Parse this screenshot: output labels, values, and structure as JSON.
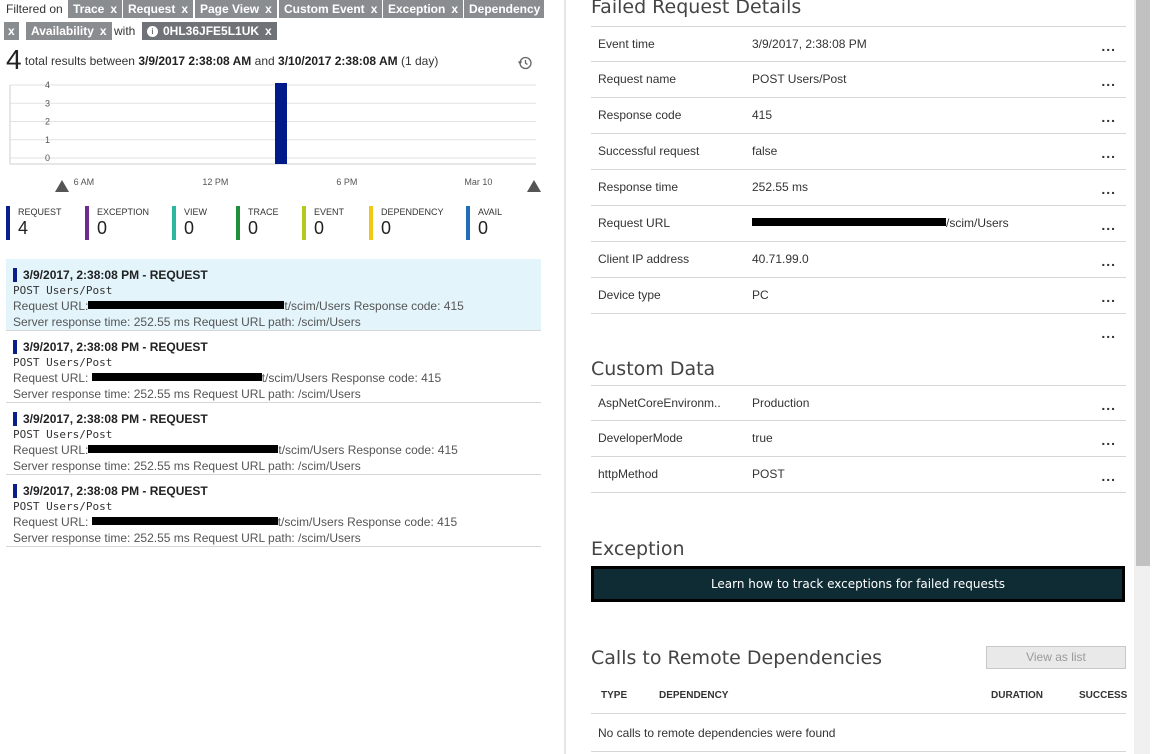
{
  "filters": {
    "label": "Filtered on",
    "chips": [
      "Trace",
      "Request",
      "Page View",
      "Custom Event",
      "Exception",
      "Dependency",
      "x",
      "Availability"
    ],
    "with_label": "with",
    "operation_chip": "0HL36JFE5L1UK",
    "chip_close": "x"
  },
  "summary": {
    "count": "4",
    "text_prefix": "total results between",
    "start": "3/9/2017 2:38:08 AM",
    "and": "and",
    "end": "3/10/2017 2:38:08 AM",
    "span": "(1 day)"
  },
  "chart_data": {
    "type": "bar",
    "title": "",
    "xlabel": "",
    "ylabel": "",
    "y_ticks": [
      "4",
      "3",
      "2",
      "1",
      "0"
    ],
    "ylim": [
      0,
      4
    ],
    "x_ticks": [
      "6 AM",
      "12 PM",
      "6 PM",
      "Mar 10"
    ],
    "bars": [
      {
        "x": "3/9/2017 2:38 PM",
        "value": 4,
        "color": "#001a8a"
      }
    ]
  },
  "legend": [
    {
      "label": "REQUEST",
      "count": "4",
      "color": "#0b1f8a"
    },
    {
      "label": "EXCEPTION",
      "count": "0",
      "color": "#6d2c8f"
    },
    {
      "label": "VIEW",
      "count": "0",
      "color": "#2bb8a0"
    },
    {
      "label": "TRACE",
      "count": "0",
      "color": "#1f8f3a"
    },
    {
      "label": "EVENT",
      "count": "0",
      "color": "#b8c91e"
    },
    {
      "label": "DEPENDENCY",
      "count": "0",
      "color": "#f2c811"
    },
    {
      "label": "AVAIL",
      "count": "0",
      "color": "#1e6fb5"
    }
  ],
  "results": [
    {
      "title": "3/9/2017, 2:38:08 PM - REQUEST",
      "op": "POST Users/Post",
      "url_label": "Request URL:",
      "url_tail": "t/scim/Users",
      "code_label": "Response code: 415",
      "time_label": "Server response time: 252.55 ms",
      "path_label": "Request URL path: /scim/Users"
    },
    {
      "title": "3/9/2017, 2:38:08 PM - REQUEST",
      "op": "POST Users/Post",
      "url_label": "Request URL:",
      "url_tail": "t/scim/Users",
      "code_label": "Response code: 415",
      "time_label": "Server response time: 252.55 ms",
      "path_label": "Request URL path: /scim/Users"
    },
    {
      "title": "3/9/2017, 2:38:08 PM - REQUEST",
      "op": "POST Users/Post",
      "url_label": "Request URL:",
      "url_tail": "t/scim/Users",
      "code_label": "Response code: 415",
      "time_label": "Server response time: 252.55 ms",
      "path_label": "Request URL path: /scim/Users"
    },
    {
      "title": "3/9/2017, 2:38:08 PM - REQUEST",
      "op": "POST Users/Post",
      "url_label": "Request URL:",
      "url_tail": "t/scim/Users",
      "code_label": "Response code: 415",
      "time_label": "Server response time: 252.55 ms",
      "path_label": "Request URL path: /scim/Users"
    }
  ],
  "details": {
    "title": "Failed Request Details",
    "rows": [
      {
        "key": "Event time",
        "value": "3/9/2017, 2:38:08 PM"
      },
      {
        "key": "Request name",
        "value": "POST Users/Post"
      },
      {
        "key": "Response code",
        "value": "415"
      },
      {
        "key": "Successful request",
        "value": "false"
      },
      {
        "key": "Response time",
        "value": "252.55 ms"
      },
      {
        "key": "Request URL",
        "value": "/scim/Users"
      },
      {
        "key": "Client IP address",
        "value": "40.71.99.0"
      },
      {
        "key": "Device type",
        "value": "PC"
      }
    ],
    "more": "..."
  },
  "custom_data": {
    "title": "Custom Data",
    "rows": [
      {
        "key": "AspNetCoreEnvironm..",
        "value": "Production"
      },
      {
        "key": "DeveloperMode",
        "value": "true"
      },
      {
        "key": "httpMethod",
        "value": "POST"
      }
    ]
  },
  "exception": {
    "title": "Exception",
    "button": "Learn how to track exceptions for failed requests"
  },
  "dependencies": {
    "title": "Calls to Remote Dependencies",
    "view_as_list": "View as list",
    "headers": [
      "TYPE",
      "DEPENDENCY",
      "DURATION",
      "SUCCESS"
    ],
    "empty": "No calls to remote dependencies were found"
  }
}
